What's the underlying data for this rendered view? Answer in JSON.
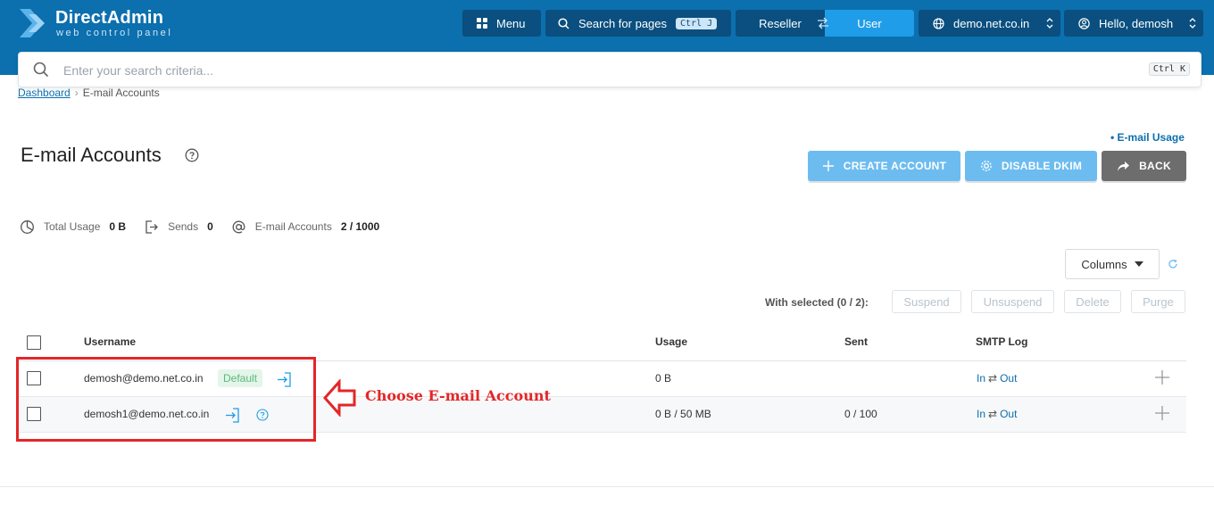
{
  "header": {
    "logo_title": "DirectAdmin",
    "logo_subtitle": "web control panel",
    "menu_label": "Menu",
    "search_label": "Search for pages",
    "search_shortcut": "Ctrl J",
    "reseller_label": "Reseller",
    "user_label": "User",
    "domain_label": "demo.net.co.in",
    "greeting": "Hello, demosh",
    "colors": {
      "bar": "#0c6fae",
      "button": "#0a4f7f",
      "active_segment": "#1f9de8"
    }
  },
  "search": {
    "placeholder": "Enter your search criteria...",
    "shortcut": "Ctrl K"
  },
  "breadcrumb": {
    "root": "Dashboard",
    "current": "E-mail Accounts"
  },
  "page": {
    "title": "E-mail Accounts",
    "usage_link": "• E-mail Usage"
  },
  "actions": {
    "create": "CREATE ACCOUNT",
    "dkim": "DISABLE DKIM",
    "back": "BACK"
  },
  "stats": {
    "total_usage_label": "Total Usage",
    "total_usage_value": "0 B",
    "sends_label": "Sends",
    "sends_value": "0",
    "accounts_label": "E-mail Accounts",
    "accounts_value": "2 / 1000"
  },
  "table_controls": {
    "columns_label": "Columns",
    "with_selected": "With selected (0 / 2):",
    "suspend": "Suspend",
    "unsuspend": "Unsuspend",
    "delete": "Delete",
    "purge": "Purge"
  },
  "table": {
    "headers": [
      "Username",
      "Usage",
      "Sent",
      "SMTP Log"
    ],
    "rows": [
      {
        "username": "demosh@demo.net.co.in",
        "badge": "Default",
        "usage": "0 B",
        "sent": "",
        "smtp_in": "In",
        "smtp_arrows": "⇄",
        "smtp_out": "Out"
      },
      {
        "username": "demosh1@demo.net.co.in",
        "badge": "",
        "usage": "0 B / 50 MB",
        "sent": "0 / 100",
        "smtp_in": "In",
        "smtp_arrows": "⇄",
        "smtp_out": "Out"
      }
    ]
  },
  "annotation": {
    "text": "Choose E-mail Account",
    "color": "#e32628"
  }
}
